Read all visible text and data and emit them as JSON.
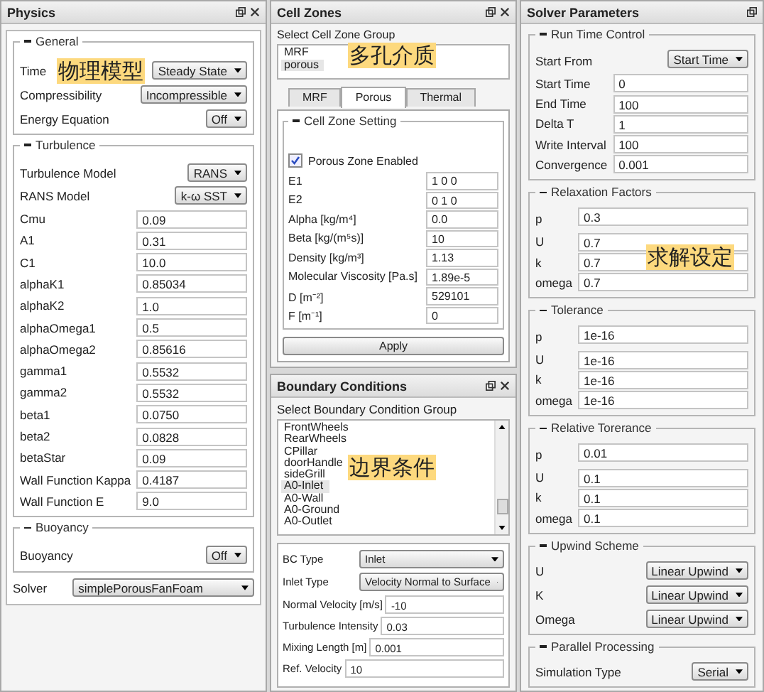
{
  "physics": {
    "title": "Physics",
    "annotation": "物理模型",
    "groups": [
      {
        "title": "General",
        "rows": [
          {
            "kind": "select",
            "label": "Time",
            "value": "Steady State"
          },
          {
            "kind": "select",
            "label": "Compressibility",
            "value": "Incompressible"
          },
          {
            "kind": "select",
            "label": "Energy Equation",
            "value": "Off"
          }
        ]
      },
      {
        "title": "Turbulence",
        "rows": [
          {
            "kind": "select",
            "label": "Turbulence Model",
            "value": "RANS"
          },
          {
            "kind": "select",
            "label": "RANS Model",
            "value": "k-ω SST"
          },
          {
            "kind": "text",
            "label": "Cmu",
            "value": "0.09"
          },
          {
            "kind": "text",
            "label": "A1",
            "value": "0.31"
          },
          {
            "kind": "text",
            "label": "C1",
            "value": "10.0"
          },
          {
            "kind": "text",
            "label": "alphaK1",
            "value": "0.85034"
          },
          {
            "kind": "text",
            "label": "alphaK2",
            "value": "1.0"
          },
          {
            "kind": "text",
            "label": "alphaOmega1",
            "value": "0.5"
          },
          {
            "kind": "text",
            "label": "alphaOmega2",
            "value": "0.85616"
          },
          {
            "kind": "text",
            "label": "gamma1",
            "value": "0.5532"
          },
          {
            "kind": "text",
            "label": "gamma2",
            "value": "0.5532"
          },
          {
            "kind": "text",
            "label": "beta1",
            "value": "0.0750"
          },
          {
            "kind": "text",
            "label": "beta2",
            "value": "0.0828"
          },
          {
            "kind": "text",
            "label": "betaStar",
            "value": "0.09"
          },
          {
            "kind": "text",
            "label": "Wall Function Kappa",
            "value": "0.4187"
          },
          {
            "kind": "text",
            "label": "Wall Function E",
            "value": "9.0"
          }
        ]
      },
      {
        "title": "Buoyancy",
        "rows": [
          {
            "kind": "select",
            "label": "Buoyancy",
            "value": "Off"
          }
        ]
      }
    ],
    "solver": {
      "label": "Solver",
      "value": "simplePorousFanFoam"
    }
  },
  "cell_zones": {
    "title": "Cell Zones",
    "annotation": "多孔介质",
    "list_label": "Select Cell Zone Group",
    "list": [
      {
        "label": "MRF",
        "selected": false
      },
      {
        "label": "porous",
        "selected": true
      }
    ],
    "tabs": [
      {
        "label": "MRF",
        "selected": false
      },
      {
        "label": "Porous",
        "selected": true
      },
      {
        "label": "Thermal",
        "selected": false
      }
    ],
    "group_title": "Cell Zone Setting",
    "checkbox": {
      "label": "Porous Zone Enabled",
      "checked": true
    },
    "rows": [
      {
        "kind": "text",
        "label": "E1",
        "value": "1 0 0"
      },
      {
        "kind": "text",
        "label": "E2",
        "value": "0 1 0"
      },
      {
        "kind": "text",
        "label": "Alpha [kg/m⁴]",
        "value": "0.0"
      },
      {
        "kind": "text",
        "label": "Beta [kg/(m⁵s)]",
        "value": "10"
      },
      {
        "kind": "text",
        "label": "Density [kg/m³]",
        "value": "1.13"
      },
      {
        "kind": "text",
        "label": "Molecular Viscosity [Pa.s]",
        "value": "1.89e-5"
      },
      {
        "kind": "text",
        "label": "D [m⁻²]",
        "value": "529101"
      },
      {
        "kind": "text",
        "label": "F [m⁻¹]",
        "value": "0"
      }
    ],
    "apply": "Apply"
  },
  "boundary_conditions": {
    "title": "Boundary Conditions",
    "annotation": "边界条件",
    "list_label": "Select Boundary Condition Group",
    "list": [
      {
        "label": "FrontWheels",
        "selected": false
      },
      {
        "label": "RearWheels",
        "selected": false
      },
      {
        "label": "CPillar",
        "selected": false
      },
      {
        "label": "doorHandle",
        "selected": false
      },
      {
        "label": "sideGrill",
        "selected": false
      },
      {
        "label": "A0-Inlet",
        "selected": true
      },
      {
        "label": "A0-Wall",
        "selected": false
      },
      {
        "label": "A0-Ground",
        "selected": false
      },
      {
        "label": "A0-Outlet",
        "selected": false
      }
    ],
    "rows": [
      {
        "kind": "select",
        "label": "BC Type",
        "value": "Inlet"
      },
      {
        "kind": "select",
        "label": "Inlet Type",
        "value": "Velocity Normal to Surface"
      },
      {
        "kind": "text",
        "label": "Normal Velocity [m/s]",
        "value": "-10"
      },
      {
        "kind": "text",
        "label": "Turbulence Intensity",
        "value": "0.03"
      },
      {
        "kind": "text",
        "label": "Mixing Length [m]",
        "value": "0.001"
      },
      {
        "kind": "text",
        "label": "Ref. Velocity",
        "value": "10"
      }
    ]
  },
  "solver_parameters": {
    "title": "Solver Parameters",
    "annotation": "求解设定",
    "groups": [
      {
        "title": "Run Time Control",
        "rows": [
          {
            "kind": "select",
            "label": "Start From",
            "value": "Start Time"
          },
          {
            "kind": "text",
            "label": "Start Time",
            "value": "0"
          },
          {
            "kind": "text",
            "label": "End Time",
            "value": "100"
          },
          {
            "kind": "text",
            "label": "Delta T",
            "value": "1"
          },
          {
            "kind": "text",
            "label": "Write Interval",
            "value": "100"
          },
          {
            "kind": "text",
            "label": "Convergence",
            "value": "0.001"
          }
        ]
      },
      {
        "title": "Relaxation Factors",
        "rows": [
          {
            "kind": "text",
            "label": "p",
            "value": "0.3"
          },
          {
            "kind": "text",
            "label": "U",
            "value": "0.7"
          },
          {
            "kind": "text",
            "label": "k",
            "value": "0.7"
          },
          {
            "kind": "text",
            "label": "omega",
            "value": "0.7"
          }
        ]
      },
      {
        "title": "Tolerance",
        "rows": [
          {
            "kind": "text",
            "label": "p",
            "value": "1e-16"
          },
          {
            "kind": "text",
            "label": "U",
            "value": "1e-16"
          },
          {
            "kind": "text",
            "label": "k",
            "value": "1e-16"
          },
          {
            "kind": "text",
            "label": "omega",
            "value": "1e-16"
          }
        ]
      },
      {
        "title": "Relative Torerance",
        "rows": [
          {
            "kind": "text",
            "label": "p",
            "value": "0.01"
          },
          {
            "kind": "text",
            "label": "U",
            "value": "0.1"
          },
          {
            "kind": "text",
            "label": "k",
            "value": "0.1"
          },
          {
            "kind": "text",
            "label": "omega",
            "value": "0.1"
          }
        ]
      },
      {
        "title": "Upwind Scheme",
        "rows": [
          {
            "kind": "select",
            "label": "U",
            "value": "Linear Upwind"
          },
          {
            "kind": "select",
            "label": "K",
            "value": "Linear Upwind"
          },
          {
            "kind": "select",
            "label": "Omega",
            "value": "Linear Upwind"
          }
        ]
      },
      {
        "title": "Parallel Processing",
        "rows": [
          {
            "kind": "select",
            "label": "Simulation Type",
            "value": "Serial"
          }
        ]
      }
    ]
  }
}
